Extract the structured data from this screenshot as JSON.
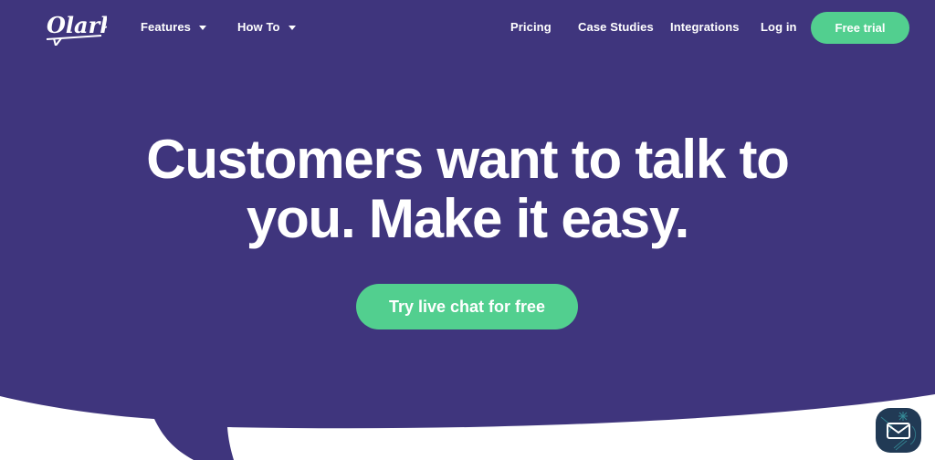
{
  "brand": {
    "logo_text": "Olark",
    "bg_color": "#3f357d",
    "accent_color": "#52cf8f"
  },
  "nav": {
    "left_items": [
      {
        "label": "Features",
        "icon": "chevron-down-icon"
      },
      {
        "label": "How To",
        "icon": "chevron-down-icon"
      }
    ],
    "right_items": [
      {
        "label": "Pricing"
      },
      {
        "label": "Case Studies"
      },
      {
        "label": "Integrations"
      },
      {
        "label": "Log in"
      }
    ],
    "cta_label": "Free trial"
  },
  "hero": {
    "headline_line1": "Customers want to talk to",
    "headline_line2": "you. Make it easy.",
    "cta_label": "Try live chat for free"
  },
  "chat_widget": {
    "icon": "envelope-icon"
  }
}
